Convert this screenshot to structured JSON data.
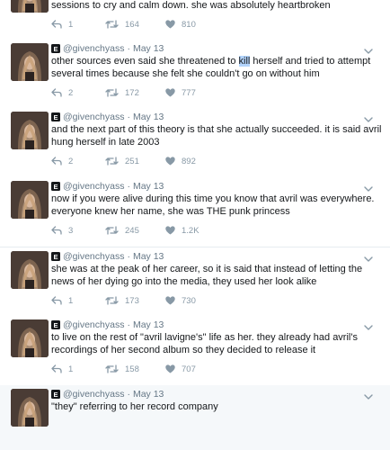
{
  "tweets": [
    {
      "handle": "@givenchyass",
      "date": "May 13",
      "text_before": "she recorded those songs, having to frequently take breaks in between sessions to cry and calm down. she was absolutely heartbroken",
      "highlight": "",
      "text_after": "",
      "replies": "1",
      "retweets": "164",
      "likes": "810"
    },
    {
      "handle": "@givenchyass",
      "date": "May 13",
      "text_before": "other sources even said she threatened to ",
      "highlight": "kill",
      "text_after": " herself and tried to attempt several times because she felt she couldn't go on without him",
      "replies": "2",
      "retweets": "172",
      "likes": "777"
    },
    {
      "handle": "@givenchyass",
      "date": "May 13",
      "text_before": "and the next part of this theory is that she actually succeeded. it is said avril hung herself in late 2003",
      "highlight": "",
      "text_after": "",
      "replies": "2",
      "retweets": "251",
      "likes": "892"
    },
    {
      "handle": "@givenchyass",
      "date": "May 13",
      "text_before": "now if you were alive during this time you know that avril was everywhere. everyone knew her name, she was THE punk princess",
      "highlight": "",
      "text_after": "",
      "replies": "3",
      "retweets": "245",
      "likes": "1.2K"
    },
    {
      "handle": "@givenchyass",
      "date": "May 13",
      "text_before": "she was at the peak of her career, so it is said that instead of letting the news of her dying go into the media, they used her look alike",
      "highlight": "",
      "text_after": "",
      "replies": "1",
      "retweets": "173",
      "likes": "730"
    },
    {
      "handle": "@givenchyass",
      "date": "May 13",
      "text_before": "to live on the rest of \"avril lavigne's\" life as her. they already had avril's recordings of her second album so they decided to release it",
      "highlight": "",
      "text_after": "",
      "replies": "1",
      "retweets": "158",
      "likes": "707"
    },
    {
      "handle": "@givenchyass",
      "date": "May 13",
      "text_before": "\"they\" referring to her record company",
      "highlight": "",
      "text_after": "",
      "replies": "",
      "retweets": "",
      "likes": ""
    }
  ],
  "icons": {
    "badge": "E",
    "reply": "reply-icon",
    "retweet": "retweet-icon",
    "like": "heart-icon",
    "more": "chevron-down-icon"
  },
  "colors": {
    "text": "#14171a",
    "muted": "#657786",
    "action": "#8899a6",
    "thread_line": "#ccd6dd",
    "highlight": "#b3d4fc"
  }
}
